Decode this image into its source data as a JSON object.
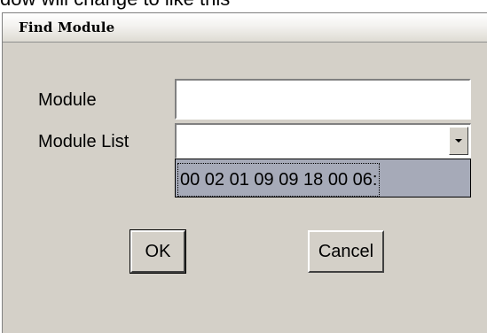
{
  "caption": {
    "fragment": "dow will change to like this"
  },
  "dialog": {
    "title": "Find Module"
  },
  "fields": {
    "module_label": "Module",
    "module_value": "",
    "module_list_label": "Module List",
    "module_list_value": ""
  },
  "dropdown": {
    "items": [
      "00 02 01 09 09 18 00 06:"
    ],
    "selected_index": 0
  },
  "buttons": {
    "ok_label": "OK",
    "cancel_label": "Cancel"
  },
  "icons": {
    "combo_arrow": "chevron-down-icon"
  }
}
